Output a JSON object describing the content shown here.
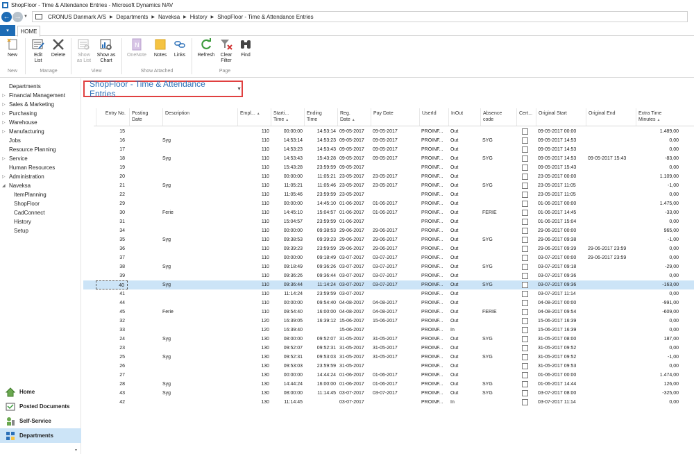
{
  "window": {
    "title": "ShopFloor - Time & Attendance Entries - Microsoft Dynamics NAV"
  },
  "address": {
    "crumbs": [
      "CRONUS Danmark A/S",
      "Departments",
      "Naveksa",
      "History",
      "ShopFloor - Time & Attendance Entries"
    ]
  },
  "tabs": {
    "file": "▾",
    "home": "HOME"
  },
  "ribbon": {
    "buttons": [
      "New",
      "Edit\nList",
      "Delete",
      "Show\nas List",
      "Show as\nChart",
      "OneNote",
      "Notes",
      "Links",
      "Refresh",
      "Clear\nFilter",
      "Find"
    ],
    "groups": [
      "New",
      "Manage",
      "View",
      "Show Attached",
      "Page"
    ]
  },
  "sidebar": {
    "items": [
      "Departments",
      "Financial Management",
      "Sales & Marketing",
      "Purchasing",
      "Warehouse",
      "Manufacturing",
      "Jobs",
      "Resource Planning",
      "Service",
      "Human Resources",
      "Administration",
      "Naveksa",
      "ItemPlanning",
      "ShopFloor",
      "CadConnect",
      "History",
      "Setup"
    ],
    "bottom": [
      "Home",
      "Posted Documents",
      "Self-Service",
      "Departments"
    ]
  },
  "page": {
    "title": "ShopFloor - Time & Attendance Entries"
  },
  "columns": [
    "Entry No.",
    "Posting\nDate",
    "Description",
    "Empl...",
    "Starti...\nTime",
    "Ending\nTime",
    "Reg.\nDate",
    "Pay Date",
    "UserId",
    "InOut",
    "Absence\ncode",
    "Cert...",
    "Original Start",
    "Original End",
    "Extra Time\nMinutes"
  ],
  "rows": [
    [
      "15",
      "",
      "",
      "110",
      "00:00:00",
      "14:53:14",
      "09-05-2017",
      "09-05-2017",
      "PROINF...",
      "Out",
      "",
      "",
      "09-05-2017 00:00",
      "",
      "1.489,00"
    ],
    [
      "16",
      "",
      "Syg",
      "110",
      "14:53:14",
      "14:53:23",
      "09-05-2017",
      "09-05-2017",
      "PROINF...",
      "Out",
      "SYG",
      "",
      "09-05-2017 14:53",
      "",
      "0,00"
    ],
    [
      "17",
      "",
      "",
      "110",
      "14:53:23",
      "14:53:43",
      "09-05-2017",
      "09-05-2017",
      "PROINF...",
      "Out",
      "",
      "",
      "09-05-2017 14:53",
      "",
      "0,00"
    ],
    [
      "18",
      "",
      "Syg",
      "110",
      "14:53:43",
      "15:43:28",
      "09-05-2017",
      "09-05-2017",
      "PROINF...",
      "Out",
      "SYG",
      "",
      "09-05-2017 14:53",
      "09-05-2017 15:43",
      "-83,00"
    ],
    [
      "19",
      "",
      "",
      "110",
      "15:43:28",
      "23:59:59",
      "09-05-2017",
      "",
      "PROINF...",
      "Out",
      "",
      "",
      "09-05-2017 15:43",
      "",
      "0,00"
    ],
    [
      "20",
      "",
      "",
      "110",
      "00:00:00",
      "11:05:21",
      "23-05-2017",
      "23-05-2017",
      "PROINF...",
      "Out",
      "",
      "",
      "23-05-2017 00:00",
      "",
      "1.109,00"
    ],
    [
      "21",
      "",
      "Syg",
      "110",
      "11:05:21",
      "11:05:46",
      "23-05-2017",
      "23-05-2017",
      "PROINF...",
      "Out",
      "SYG",
      "",
      "23-05-2017 11:05",
      "",
      "-1,00"
    ],
    [
      "22",
      "",
      "",
      "110",
      "11:05:46",
      "23:59:59",
      "23-05-2017",
      "",
      "PROINF...",
      "Out",
      "",
      "",
      "23-05-2017 11:05",
      "",
      "0,00"
    ],
    [
      "29",
      "",
      "",
      "110",
      "00:00:00",
      "14:45:10",
      "01-06-2017",
      "01-06-2017",
      "PROINF...",
      "Out",
      "",
      "",
      "01-06-2017 00:00",
      "",
      "1.475,00"
    ],
    [
      "30",
      "",
      "Ferie",
      "110",
      "14:45:10",
      "15:04:57",
      "01-06-2017",
      "01-06-2017",
      "PROINF...",
      "Out",
      "FERIE",
      "",
      "01-06-2017 14:45",
      "",
      "-33,00"
    ],
    [
      "31",
      "",
      "",
      "110",
      "15:04:57",
      "23:59:59",
      "01-06-2017",
      "",
      "PROINF...",
      "Out",
      "",
      "",
      "01-06-2017 15:04",
      "",
      "0,00"
    ],
    [
      "34",
      "",
      "",
      "110",
      "00:00:00",
      "09:38:53",
      "29-06-2017",
      "29-06-2017",
      "PROINF...",
      "Out",
      "",
      "",
      "29-06-2017 00:00",
      "",
      "965,00"
    ],
    [
      "35",
      "",
      "Syg",
      "110",
      "09:38:53",
      "09:39:23",
      "29-06-2017",
      "29-06-2017",
      "PROINF...",
      "Out",
      "SYG",
      "",
      "29-06-2017 09:38",
      "",
      "-1,00"
    ],
    [
      "36",
      "",
      "",
      "110",
      "09:39:23",
      "23:59:59",
      "29-06-2017",
      "29-06-2017",
      "PROINF...",
      "Out",
      "",
      "",
      "29-06-2017 09:39",
      "29-06-2017 23:59",
      "0,00"
    ],
    [
      "37",
      "",
      "",
      "110",
      "00:00:00",
      "09:18:49",
      "03-07-2017",
      "03-07-2017",
      "PROINF...",
      "Out",
      "",
      "",
      "03-07-2017 00:00",
      "29-06-2017 23:59",
      "0,00"
    ],
    [
      "38",
      "",
      "Syg",
      "110",
      "09:18:49",
      "09:36:26",
      "03-07-2017",
      "03-07-2017",
      "PROINF...",
      "Out",
      "SYG",
      "",
      "03-07-2017 09:18",
      "",
      "-29,00"
    ],
    [
      "39",
      "",
      "",
      "110",
      "09:36:26",
      "09:36:44",
      "03-07-2017",
      "03-07-2017",
      "PROINF...",
      "Out",
      "",
      "",
      "03-07-2017 09:36",
      "",
      "0,00"
    ],
    [
      "40",
      "",
      "Syg",
      "110",
      "09:36:44",
      "11:14:24",
      "03-07-2017",
      "03-07-2017",
      "PROINF...",
      "Out",
      "SYG",
      "",
      "03-07-2017 09:36",
      "",
      "-163,00"
    ],
    [
      "41",
      "",
      "",
      "110",
      "11:14:24",
      "23:59:59",
      "03-07-2017",
      "",
      "PROINF...",
      "Out",
      "",
      "",
      "03-07-2017 11:14",
      "",
      "0,00"
    ],
    [
      "44",
      "",
      "",
      "110",
      "00:00:00",
      "09:54:40",
      "04-08-2017",
      "04-08-2017",
      "PROINF...",
      "Out",
      "",
      "",
      "04-08-2017 00:00",
      "",
      "-991,00"
    ],
    [
      "45",
      "",
      "Ferie",
      "110",
      "09:54:40",
      "16:00:00",
      "04-08-2017",
      "04-08-2017",
      "PROINF...",
      "Out",
      "FERIE",
      "",
      "04-08-2017 09:54",
      "",
      "-609,00"
    ],
    [
      "32",
      "",
      "",
      "120",
      "16:39:05",
      "16:39:12",
      "15-06-2017",
      "15-06-2017",
      "PROINF...",
      "Out",
      "",
      "",
      "15-06-2017 16:39",
      "",
      "0,00"
    ],
    [
      "33",
      "",
      "",
      "120",
      "16:39:40",
      "",
      "15-06-2017",
      "",
      "PROINF...",
      "In",
      "",
      "",
      "15-06-2017 16:39",
      "",
      "0,00"
    ],
    [
      "24",
      "",
      "Syg",
      "130",
      "08:00:00",
      "09:52:07",
      "31-05-2017",
      "31-05-2017",
      "PROINF...",
      "Out",
      "SYG",
      "",
      "31-05-2017 08:00",
      "",
      "187,00"
    ],
    [
      "23",
      "",
      "",
      "130",
      "09:52:07",
      "09:52:31",
      "31-05-2017",
      "31-05-2017",
      "PROINF...",
      "Out",
      "",
      "",
      "31-05-2017 09:52",
      "",
      "0,00"
    ],
    [
      "25",
      "",
      "Syg",
      "130",
      "09:52:31",
      "09:53:03",
      "31-05-2017",
      "31-05-2017",
      "PROINF...",
      "Out",
      "SYG",
      "",
      "31-05-2017 09:52",
      "",
      "-1,00"
    ],
    [
      "26",
      "",
      "",
      "130",
      "09:53:03",
      "23:59:59",
      "31-05-2017",
      "",
      "PROINF...",
      "Out",
      "",
      "",
      "31-05-2017 09:53",
      "",
      "0,00"
    ],
    [
      "27",
      "",
      "",
      "130",
      "00:00:00",
      "14:44:24",
      "01-06-2017",
      "01-06-2017",
      "PROINF...",
      "Out",
      "",
      "",
      "01-06-2017 00:00",
      "",
      "1.474,00"
    ],
    [
      "28",
      "",
      "Syg",
      "130",
      "14:44:24",
      "16:00:00",
      "01-06-2017",
      "01-06-2017",
      "PROINF...",
      "Out",
      "SYG",
      "",
      "01-06-2017 14:44",
      "",
      "126,00"
    ],
    [
      "43",
      "",
      "Syg",
      "130",
      "08:00:00",
      "11:14:45",
      "03-07-2017",
      "03-07-2017",
      "PROINF...",
      "Out",
      "SYG",
      "",
      "03-07-2017 08:00",
      "",
      "-325,00"
    ],
    [
      "42",
      "",
      "",
      "130",
      "11:14:45",
      "",
      "03-07-2017",
      "",
      "PROINF...",
      "In",
      "",
      "",
      "03-07-2017 11:14",
      "",
      "0,00"
    ]
  ],
  "selected_row_index": 17,
  "colors": {
    "accent": "#1e6cb5",
    "title_text": "#2a6fb8",
    "highlight_border": "#e04040",
    "selection": "#cce4f7"
  }
}
